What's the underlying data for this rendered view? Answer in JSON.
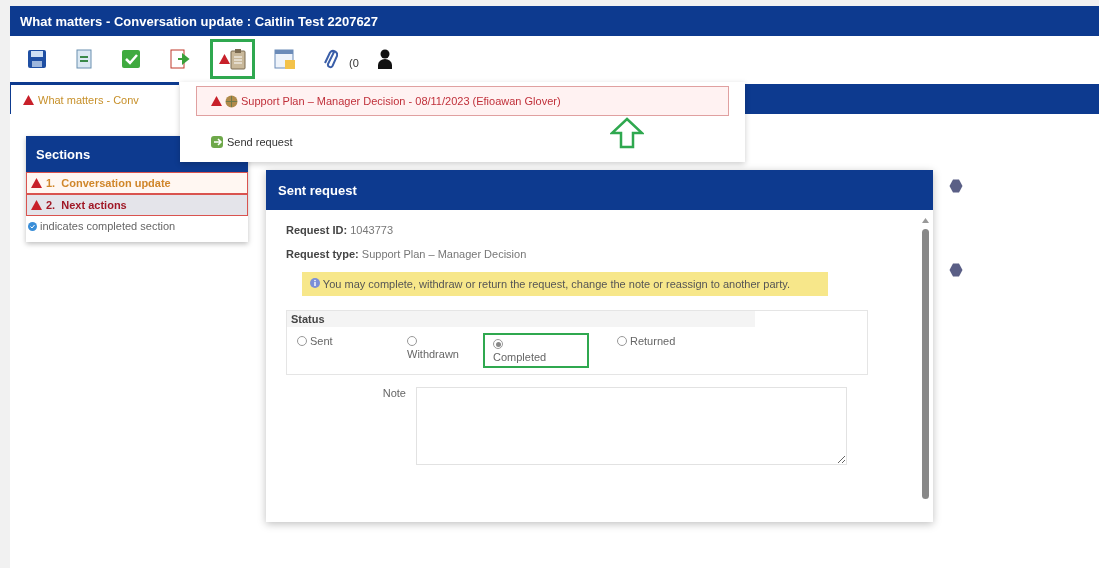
{
  "window": {
    "title": "What matters - Conversation update : Caitlin Test  2207627"
  },
  "toolbar": {
    "items": [
      {
        "kind": "save",
        "selected": false
      },
      {
        "kind": "refresh",
        "selected": false
      },
      {
        "kind": "check",
        "selected": false
      },
      {
        "kind": "export",
        "selected": false
      },
      {
        "kind": "requests",
        "selected": true
      },
      {
        "kind": "calendar",
        "selected": false
      },
      {
        "kind": "attach",
        "selected": false
      },
      {
        "kind": "person",
        "selected": false
      }
    ],
    "attachments_count": "(0"
  },
  "tabs": [
    {
      "label": "What matters - Conv",
      "warning": true,
      "selected": true
    }
  ],
  "dropdown": {
    "items": [
      {
        "kind": "request",
        "label": "Support Plan – Manager Decision - 08/11/2023 (Efioawan Glover)",
        "warning": true,
        "selected": true
      },
      {
        "kind": "action",
        "label": "Send request",
        "warning": false,
        "selected": false
      }
    ]
  },
  "sections": {
    "title": "Sections",
    "items": [
      {
        "number": "1.",
        "label": "Conversation update",
        "warning": true,
        "selected": false
      },
      {
        "number": "2.",
        "label": "Next actions",
        "warning": true,
        "selected": true
      }
    ],
    "legend": "indicates completed section"
  },
  "dialog": {
    "title": "Sent request",
    "fields": [
      {
        "label": "Request ID:",
        "value": "1043773"
      },
      {
        "label": "Request type:",
        "value": "Support Plan – Manager Decision"
      }
    ],
    "info": "You may complete, withdraw or return the request, change the note or reassign to another party.",
    "status": {
      "legend": "Status",
      "options": [
        {
          "label": "Sent",
          "kind": "inline",
          "selected": false,
          "highlighted": false
        },
        {
          "label": "Withdrawn",
          "kind": "stacked",
          "selected": false,
          "highlighted": false
        },
        {
          "label": "Completed",
          "kind": "stacked",
          "selected": true,
          "highlighted": true
        },
        {
          "label": "Returned",
          "kind": "inline",
          "selected": false,
          "highlighted": false
        }
      ]
    },
    "note": {
      "label": "Note"
    }
  }
}
